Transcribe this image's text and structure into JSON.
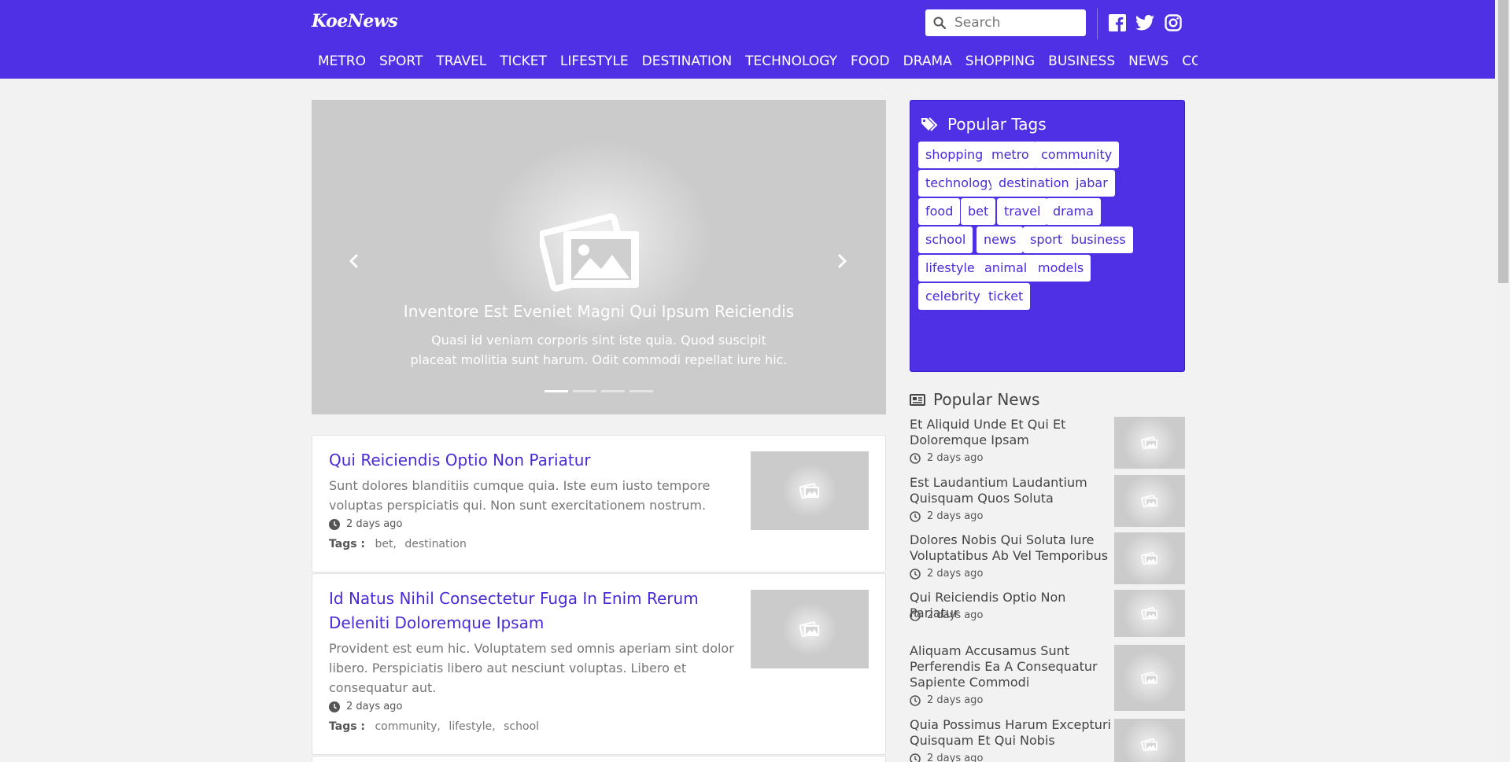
{
  "brand": {
    "logo": "KoeNews",
    "accent": "#5030e5"
  },
  "search": {
    "placeholder": "Search"
  },
  "social": [
    "facebook-icon",
    "twitter-icon",
    "instagram-icon"
  ],
  "nav": {
    "items": [
      "METRO",
      "SPORT",
      "TRAVEL",
      "TICKET",
      "LIFESTYLE",
      "DESTINATION",
      "TECHNOLOGY",
      "FOOD",
      "DRAMA",
      "SHOPPING",
      "BUSINESS",
      "NEWS",
      "COMMUNITY"
    ]
  },
  "hero": {
    "title": "Inventore Est Eveniet Magni Qui Ipsum Reiciendis",
    "description": "Quasi id veniam corporis sint iste quia. Quod suscipit placeat mollitia sunt harum. Odit commodi repellat iure hic.",
    "slide_count": 4,
    "active_slide": 1
  },
  "articles": [
    {
      "title": "Qui Reiciendis Optio Non Pariatur",
      "description": "Sunt dolores blanditiis cumque quia. Iste eum iusto tempore voluptas perspiciatis qui. Non sunt exercitationem nostrum.",
      "time": "2 days ago",
      "tags_label": "Tags :",
      "tags": [
        "bet,",
        "destination"
      ]
    },
    {
      "title": "Id Natus Nihil Consectetur Fuga In Enim Rerum Deleniti Doloremque Ipsam",
      "description": "Provident est eum hic. Voluptatem sed omnis aperiam sint dolor libero. Perspiciatis libero aut nesciunt voluptas. Libero et consequatur aut.",
      "time": "2 days ago",
      "tags_label": "Tags :",
      "tags": [
        "community,",
        "lifestyle,",
        "school"
      ]
    }
  ],
  "popular_tags": {
    "heading": "Popular Tags",
    "tags": [
      "shopping",
      "metro",
      "community",
      "technology",
      "destination",
      "jabar",
      "food",
      "bet",
      "travel",
      "drama",
      "school",
      "news",
      "sport",
      "business",
      "lifestyle",
      "animal",
      "models",
      "celebrity",
      "ticket"
    ]
  },
  "popular_news": {
    "heading": "Popular News",
    "items": [
      {
        "title": "Et Aliquid Unde Et Qui Et Doloremque Ipsam",
        "time": "2 days ago"
      },
      {
        "title": "Est Laudantium Laudantium Quisquam Quos Soluta",
        "time": "2 days ago"
      },
      {
        "title": "Dolores Nobis Qui Soluta Iure Voluptatibus Ab Vel Temporibus",
        "time": "2 days ago"
      },
      {
        "title": "Qui Reiciendis Optio Non Pariatur",
        "time": "2 days ago"
      },
      {
        "title": "Aliquam Accusamus Sunt Perferendis Ea A Consequatur Sapiente Commodi",
        "time": "2 days ago"
      },
      {
        "title": "Quia Possimus Harum Excepturi Quisquam Et Qui Nobis",
        "time": "2 days ago"
      }
    ]
  }
}
